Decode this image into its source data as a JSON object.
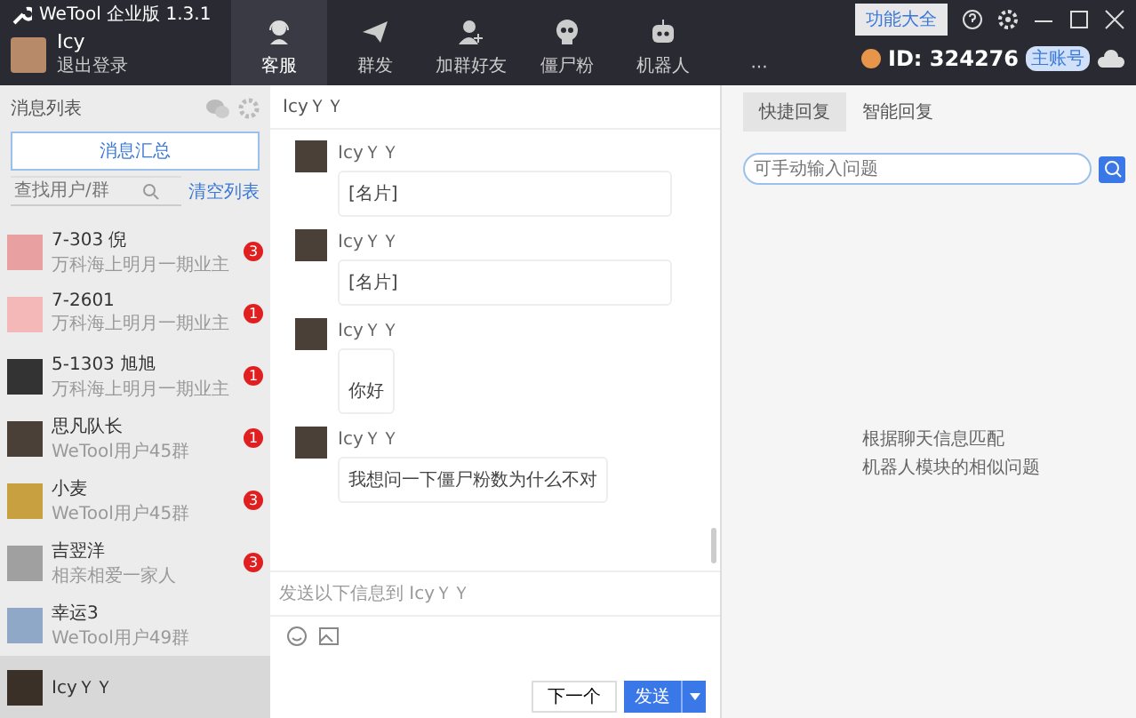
{
  "window": {
    "title": "WeTool 企业版 1.3.1",
    "feature_button": "功能大全"
  },
  "account": {
    "name": "Icy",
    "logout": "退出登录",
    "id": "ID: 324276",
    "badge": "主账号"
  },
  "nav": [
    {
      "label": "客服",
      "selected": true
    },
    {
      "label": "群发",
      "selected": false
    },
    {
      "label": "加群好友",
      "selected": false
    },
    {
      "label": "僵尸粉",
      "selected": false
    },
    {
      "label": "机器人",
      "selected": false
    },
    {
      "label": "···",
      "selected": false
    }
  ],
  "sidebar": {
    "title": "消息列表",
    "summary_button": "消息汇总",
    "search": {
      "placeholder": "查找用户/群"
    },
    "clear_link": "清空列表",
    "items": [
      {
        "name": "7-303 倪",
        "sub": "万科海上明月一期业主",
        "unread": "3",
        "selected": false,
        "color": "#e8a0a0"
      },
      {
        "name": "7-2601",
        "sub": "万科海上明月一期业主",
        "unread": "1",
        "selected": false,
        "color": "#f4b8b8"
      },
      {
        "name": "5-1303 旭旭",
        "sub": "万科海上明月一期业主",
        "unread": "1",
        "selected": false,
        "color": "#333333"
      },
      {
        "name": "思凡队长",
        "sub": "WeTool用户45群",
        "unread": "1",
        "selected": false,
        "color": "#4a4038"
      },
      {
        "name": "小麦",
        "sub": "WeTool用户45群",
        "unread": "3",
        "selected": false,
        "color": "#c9a040"
      },
      {
        "name": "吉翌洋",
        "sub": "相亲相爱一家人",
        "unread": "3",
        "selected": false,
        "color": "#a0a0a0"
      },
      {
        "name": "幸运3",
        "sub": "WeTool用户49群",
        "selected": false,
        "color": "#8fa8c8"
      },
      {
        "name": "IcyＹＹ",
        "selected": true,
        "color": "#3a3028"
      }
    ]
  },
  "chat": {
    "title": "IcyＹＹ",
    "messages": [
      {
        "sender": "IcyＹＹ",
        "text": "[名片]",
        "kind": "wide"
      },
      {
        "sender": "IcyＹＹ",
        "text": "[名片]",
        "kind": "wide"
      },
      {
        "sender": "IcyＹＹ",
        "text": "你好",
        "kind": "tall"
      },
      {
        "sender": "IcyＹＹ",
        "text": "我想问一下僵尸粉数为什么不对",
        "kind": "normal"
      }
    ],
    "send_to": "发送以下信息到 IcyＹＹ",
    "next_button": "下一个",
    "send_button": "发送"
  },
  "reply_panel": {
    "tabs": [
      {
        "label": "快捷回复",
        "selected": true
      },
      {
        "label": "智能回复",
        "selected": false
      }
    ],
    "search": {
      "placeholder": "可手动输入问题"
    },
    "hint": [
      "根据聊天信息匹配",
      "机器人模块的相似问题"
    ]
  }
}
